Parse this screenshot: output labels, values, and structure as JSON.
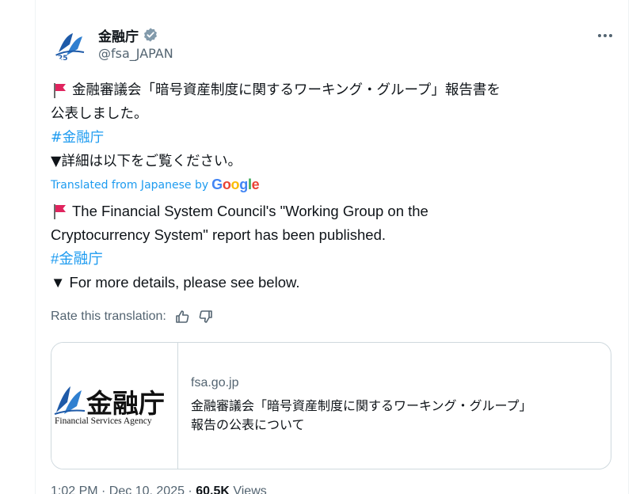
{
  "account": {
    "display_name": "金融庁",
    "handle": "@fsa_JAPAN",
    "verified": true,
    "avatar_icon": "fsa-logo-icon"
  },
  "tweet": {
    "lines": [
      "金融審議会「暗号資産制度に関するワーキング・グループ」報告書を",
      "公表しました。",
      "#金融庁",
      "▼詳細は以下をご覧ください。"
    ]
  },
  "translation": {
    "label": "Translated from Japanese by",
    "provider": "Google",
    "lines": [
      "The Financial System Council's \"Working Group on the",
      "Cryptocurrency System\" report has been published.",
      "#金融庁",
      "▼ For more details, please see below."
    ],
    "rate_label": "Rate this translation:"
  },
  "card": {
    "logo_text": "金融庁",
    "logo_subtext": "Financial Services Agency",
    "domain": "fsa.go.jp",
    "title_line1": "金融審議会「暗号資産制度に関するワーキング・グループ」",
    "title_line2": "報告の公表について"
  },
  "meta": {
    "time": "1:02 PM · Dec 10, 2025 · ",
    "views_count": "60.5K",
    "views_label": " Views"
  },
  "colors": {
    "link": "#1d9bf0",
    "secondary_text": "#536471",
    "border": "#cfd9de"
  }
}
